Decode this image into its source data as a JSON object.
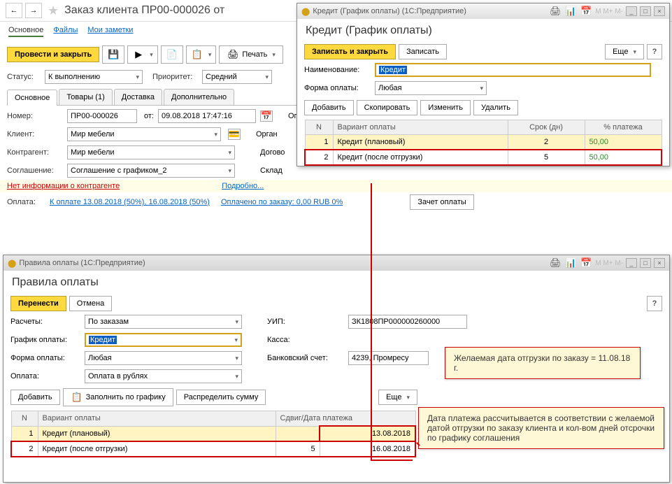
{
  "header": {
    "title": "Заказ клиента ПР00-000026 от",
    "tabs": {
      "main": "Основное",
      "files": "Файлы",
      "notes": "Мои заметки"
    }
  },
  "toolbar": {
    "post_close": "Провести и закрыть",
    "print": "Печать"
  },
  "fields": {
    "status_label": "Статус:",
    "status_value": "К выполнению",
    "priority_label": "Приоритет:",
    "priority_value": "Средний",
    "number_label": "Номер:",
    "number_value": "ПР00-000026",
    "from_label": "от:",
    "date_value": "09.08.2018 17:47:16",
    "oper_label": "Опера",
    "client_label": "Клиент:",
    "client_value": "Мир мебели",
    "org_label": "Орган",
    "contragent_label": "Контрагент:",
    "contragent_value": "Мир мебели",
    "dogovor_label": "Догово",
    "agreement_label": "Соглашение:",
    "agreement_value": "Соглашение с графиком_2",
    "sklad_label": "Склад",
    "no_info": "Нет информации о контрагенте",
    "more_link": "Подробно...",
    "payment_label": "Оплата:",
    "payment_info": "К оплате 13.08.2018 (50%), 16.08.2018 (50%)",
    "paid_info": "Оплачено по заказу: 0,00 RUB  0%",
    "offset_btn": "Зачет оплаты"
  },
  "subtabs": {
    "main": "Основное",
    "goods": "Товары (1)",
    "delivery": "Доставка",
    "extra": "Дополнительно"
  },
  "credit_dialog": {
    "win_title": "Кредит (График оплаты) (1С:Предприятие)",
    "title": "Кредит (График оплаты)",
    "save_close": "Записать и закрыть",
    "save": "Записать",
    "more": "Еще",
    "name_label": "Наименование:",
    "name_value": "Кредит",
    "form_label": "Форма оплаты:",
    "form_value": "Любая",
    "add": "Добавить",
    "copy": "Скопировать",
    "edit": "Изменить",
    "delete": "Удалить",
    "cols": {
      "n": "N",
      "variant": "Вариант оплаты",
      "term": "Срок (дн)",
      "pct": "% платежа"
    },
    "rows": [
      {
        "n": "1",
        "variant": "Кредит (плановый)",
        "term": "2",
        "pct": "50,00"
      },
      {
        "n": "2",
        "variant": "Кредит (после отгрузки)",
        "term": "5",
        "pct": "50,00"
      }
    ]
  },
  "rules_dialog": {
    "win_title": "Правила оплаты (1С:Предприятие)",
    "title": "Правила оплаты",
    "transfer": "Перенести",
    "cancel": "Отмена",
    "calc_label": "Расчеты:",
    "calc_value": "По заказам",
    "uip_label": "УИП:",
    "uip_value": "ЗК1808ПР000000260000",
    "schedule_label": "График оплаты:",
    "schedule_value": "Кредит",
    "kassa_label": "Касса:",
    "form_label": "Форма оплаты:",
    "form_value": "Любая",
    "account_label": "Банковский счет:",
    "account_value": "4239, Промресу",
    "payment_label": "Оплата:",
    "payment_value": "Оплата в рублях",
    "add": "Добавить",
    "fill": "Заполнить по графику",
    "distribute": "Распределить сумму",
    "more": "Еще",
    "cols": {
      "n": "N",
      "variant": "Вариант оплаты",
      "shift": "Сдвиг/Дата платежа"
    },
    "rows": [
      {
        "n": "1",
        "variant": "Кредит (плановый)",
        "shift": "",
        "date": "13.08.2018"
      },
      {
        "n": "2",
        "variant": "Кредит (после отгрузки)",
        "shift": "5",
        "date": "16.08.2018"
      }
    ]
  },
  "callouts": {
    "c1": "Желаемая дата отгрузки по заказу = 11.08.18 г.",
    "c2": "Дата платежа рассчитывается в соответствии с желаемой датой отгрузки по заказу клиента и кол-вом дней отсрочки по графику соглашения"
  }
}
